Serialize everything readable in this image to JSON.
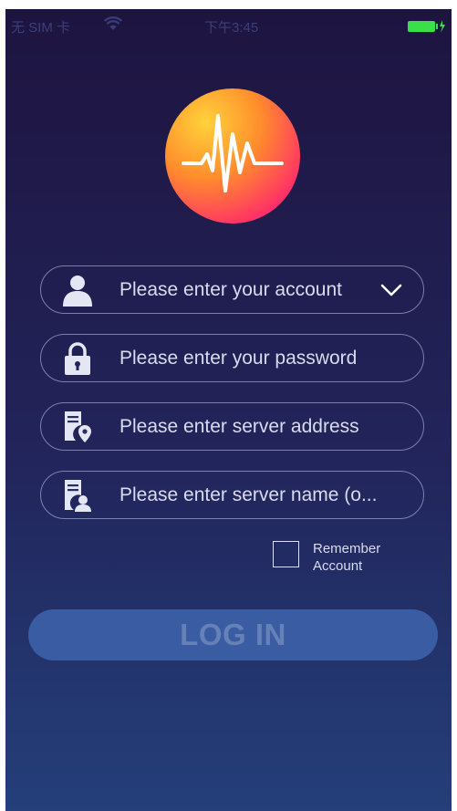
{
  "status_bar": {
    "carrier": "无 SIM 卡",
    "time": "下午3:45"
  },
  "login_form": {
    "account_placeholder": "Please enter your account",
    "password_placeholder": "Please enter your password",
    "server_address_placeholder": "Please enter server address",
    "server_name_placeholder": "Please enter server name (o...",
    "remember_label": "Remember Account",
    "remember_checked": false,
    "login_label": "LOG IN"
  },
  "icons": {
    "logo": "heartbeat-logo-icon",
    "account": "user-icon",
    "password": "lock-icon",
    "server_address": "server-location-icon",
    "server_name": "server-user-icon",
    "dropdown": "chevron-down-icon"
  },
  "colors": {
    "background_top": "#1e1440",
    "background_bottom": "#243f7a",
    "logo_gradient_start": "#ffd23a",
    "logo_gradient_end": "#f51c7a",
    "login_button": "#3a5ca3",
    "text": "#d9dbef"
  }
}
